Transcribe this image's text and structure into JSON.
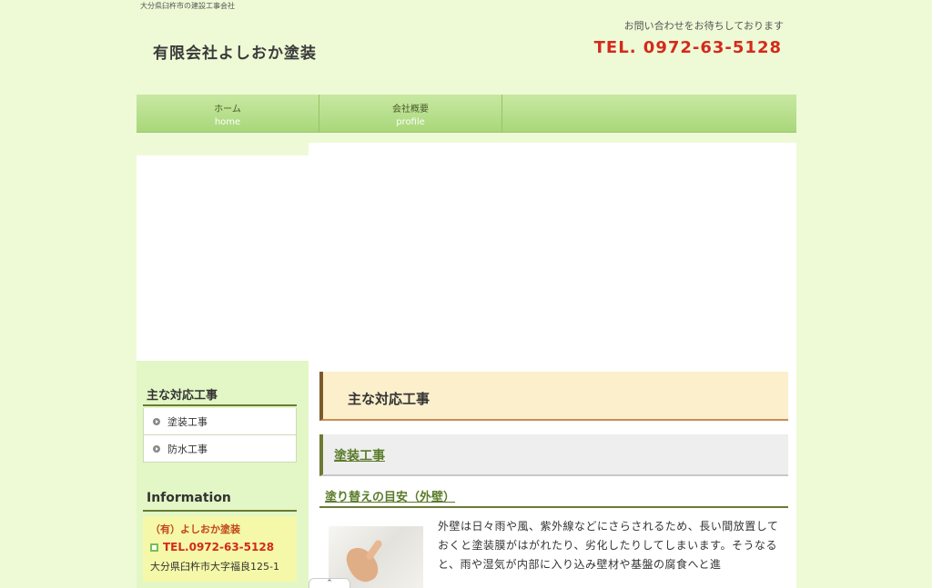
{
  "header": {
    "tagline": "大分県臼杵市の建設工事会社",
    "site_title": "有限会社よしおか塗装",
    "contact_message": "お問い合わせをお待ちしております",
    "tel": "TEL. 0972-63-5128"
  },
  "nav": [
    {
      "label": "ホーム",
      "sub": "home"
    },
    {
      "label": "会社概要",
      "sub": "profile"
    }
  ],
  "sidebar": {
    "services_heading": "主な対応工事",
    "services": [
      "塗装工事",
      "防水工事"
    ],
    "info_heading": "Information",
    "company": "（有）よしおか塗装",
    "tel": "TEL.0972-63-5128",
    "address": "大分県臼杵市大字福良125-1"
  },
  "main": {
    "section_title": "主な対応工事",
    "sub_title": "塗装工事",
    "minor_title": "塗り替えの目安（外壁）",
    "body": "外壁は日々雨や風、紫外線などにさらされるため、長い間放置しておくと塗装膜がはがれたり、劣化したりしてしまいます。そうなると、雨や湿気が内部に入り込み壁材や基盤の腐食へと進"
  },
  "scroll_top": {
    "icon": "chevron-up-icon",
    "glyph": "⌃"
  }
}
